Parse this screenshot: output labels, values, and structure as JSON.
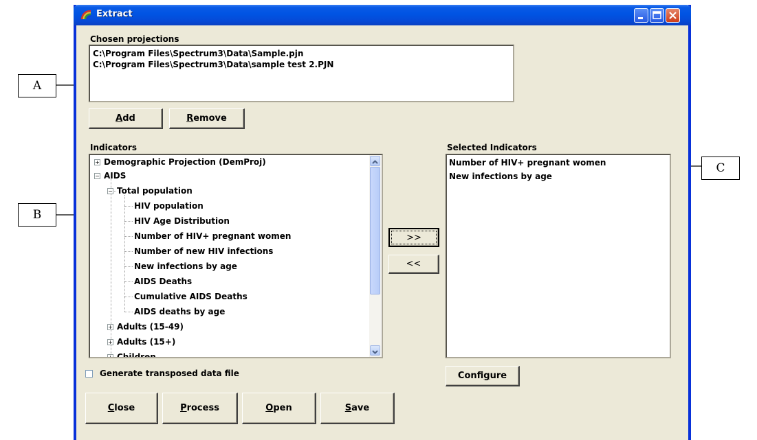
{
  "window": {
    "title": "Extract"
  },
  "chosen_projections": {
    "label": "Chosen projections",
    "items": [
      "C:\\Program Files\\Spectrum3\\Data\\Sample.pjn",
      "C:\\Program Files\\Spectrum3\\Data\\sample test 2.PJN"
    ]
  },
  "buttons": {
    "add": {
      "key": "A",
      "rest": "dd"
    },
    "remove": {
      "key": "R",
      "rest": "emove"
    },
    "move_right": ">>",
    "move_left": "<<",
    "configure": {
      "pre": "Confi",
      "key": "g",
      "rest": "ure"
    },
    "close": {
      "key": "C",
      "rest": "lose"
    },
    "process": {
      "key": "P",
      "rest": "rocess"
    },
    "open": {
      "key": "O",
      "rest": "pen"
    },
    "save": {
      "key": "S",
      "rest": "ave"
    }
  },
  "indicators": {
    "label": "Indicators",
    "tree": {
      "root1": "Demographic Projection (DemProj)",
      "root2": "AIDS",
      "group": "Total population",
      "leaves": [
        "HIV population",
        "HIV Age Distribution",
        "Number of HIV+ pregnant women",
        "Number of new HIV infections",
        "New infections by age",
        "AIDS Deaths",
        "Cumulative AIDS Deaths",
        "AIDS deaths by age"
      ],
      "collapsed_groups": [
        "Adults (15-49)",
        "Adults (15+)",
        "Children"
      ]
    }
  },
  "selected_indicators": {
    "label": "Selected Indicators",
    "items": [
      "Number of HIV+ pregnant women",
      "New infections by age"
    ]
  },
  "transpose_checkbox": {
    "label": "Generate transposed data file",
    "checked": false
  },
  "annotations": {
    "a": "A",
    "b": "B",
    "c": "C"
  },
  "colors": {
    "window_bg": "#ece9d8",
    "titlebar": "#0054e3"
  }
}
